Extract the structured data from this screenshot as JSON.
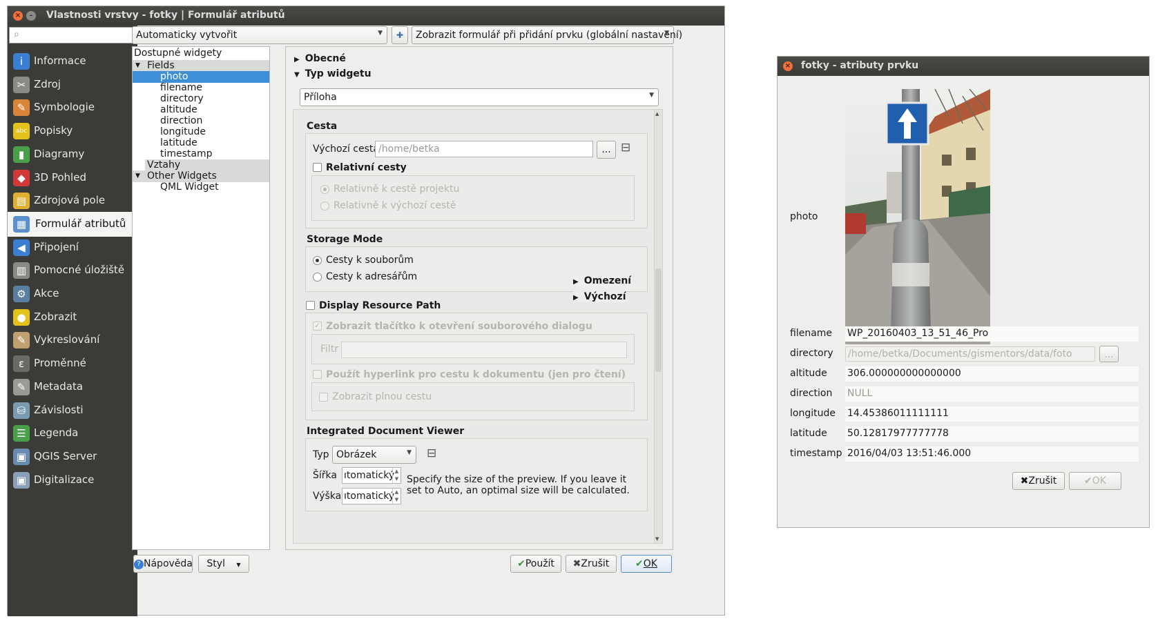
{
  "main_window": {
    "title": "Vlastnosti vrstvy - fotky | Formulář atributů",
    "close_glyph": "×",
    "minimize_glyph": "–",
    "sidebar": {
      "search_placeholder": "",
      "items": [
        {
          "label": "Informace",
          "icon": "info-icon",
          "color": "#3a7fd2",
          "glyph": "i"
        },
        {
          "label": "Zdroj",
          "icon": "wrench-icon",
          "color": "#8a8a86",
          "glyph": "✂"
        },
        {
          "label": "Symbologie",
          "icon": "brush-icon",
          "color": "#d9863a",
          "glyph": "✎"
        },
        {
          "label": "Popisky",
          "icon": "label-icon",
          "color": "#e3c21c",
          "glyph": "abc"
        },
        {
          "label": "Diagramy",
          "icon": "diagram-icon",
          "color": "#4aa04a",
          "glyph": "▮"
        },
        {
          "label": "3D Pohled",
          "icon": "cube-icon",
          "color": "#d23a3a",
          "glyph": "◆"
        },
        {
          "label": "Zdrojová pole",
          "icon": "fields-icon",
          "color": "#e0b030",
          "glyph": "▤"
        },
        {
          "label": "Formulář atributů",
          "icon": "form-icon",
          "color": "#5a8fd0",
          "glyph": "▦"
        },
        {
          "label": "Připojení",
          "icon": "join-icon",
          "color": "#3a7fd2",
          "glyph": "◀"
        },
        {
          "label": "Pomocné úložiště",
          "icon": "storage-icon",
          "color": "#8a8a86",
          "glyph": "▥"
        },
        {
          "label": "Akce",
          "icon": "gear-icon",
          "color": "#5a7fa0",
          "glyph": "⚙"
        },
        {
          "label": "Zobrazit",
          "icon": "speech-bubble-icon",
          "color": "#e3c21c",
          "glyph": "●"
        },
        {
          "label": "Vykreslování",
          "icon": "paintbrush-icon",
          "color": "#c0a070",
          "glyph": "✎"
        },
        {
          "label": "Proměnné",
          "icon": "epsilon-icon",
          "color": "#6a6a66",
          "glyph": "ε"
        },
        {
          "label": "Metadata",
          "icon": "metadata-icon",
          "color": "#9a9a96",
          "glyph": "✎"
        },
        {
          "label": "Závislosti",
          "icon": "dependencies-icon",
          "color": "#7a9ab0",
          "glyph": "⛁"
        },
        {
          "label": "Legenda",
          "icon": "legend-icon",
          "color": "#4aa04a",
          "glyph": "☰"
        },
        {
          "label": "QGIS Server",
          "icon": "server-icon",
          "color": "#6a8ab0",
          "glyph": "▣"
        },
        {
          "label": "Digitalizace",
          "icon": "digitize-icon",
          "color": "#8aa0b8",
          "glyph": "▣"
        }
      ],
      "active_index": 7
    },
    "toolbar": {
      "layout_combo": "Automaticky vytvořit",
      "python_icon": "python-icon",
      "python_glyph": "✚",
      "form_mode_combo": "Zobrazit formulář při přidání prvku (globální nastavení)"
    },
    "tree": {
      "header": "Dostupné widgety",
      "fields_group": "Fields",
      "fields": [
        "photo",
        "filename",
        "directory",
        "altitude",
        "direction",
        "longitude",
        "latitude",
        "timestamp"
      ],
      "selected_field": "photo",
      "relations_group": "Vztahy",
      "other_group": "Other Widgets",
      "other_items": [
        "QML Widget"
      ],
      "expand_glyph": "▼"
    },
    "panel": {
      "general_section": "Obecné",
      "widget_type_section": "Typ widgetu",
      "collapsed_glyph": "▶",
      "expanded_glyph": "▼",
      "widget_type": "Příloha",
      "path_group": "Cesta",
      "default_path_label": "Výchozí cesta",
      "default_path_placeholder": "/home/betka",
      "browse_button": "...",
      "expression_icon": "expression-icon",
      "expression_glyph": "⊟",
      "relative_paths_label": "Relativní cesty",
      "relative_project": "Relativně k cestě projektu",
      "relative_default": "Relativně k výchozí cestě",
      "storage_mode_group": "Storage Mode",
      "storage_files": "Cesty k souborům",
      "storage_dirs": "Cesty k adresářům",
      "constraints_section": "Omezení",
      "defaults_section": "Výchozí",
      "display_resource_path": "Display Resource Path",
      "show_file_dialog": "Zobrazit tlačítko k otevření souborového dialogu",
      "filter_label": "Filtr",
      "use_hyperlink": "Použít hyperlink pro cestu k dokumentu (jen pro čtení)",
      "show_full_path": "Zobrazit plnou cestu",
      "viewer_group": "Integrated Document Viewer",
      "type_label": "Typ",
      "type_value": "Obrázek",
      "width_label": "Šířka",
      "height_label": "Výška",
      "width_value": "ıtomatický",
      "height_value": "ıtomatický",
      "size_hint": "Specify the size of the preview. If you leave it set to Auto, an optimal size will be calculated.",
      "check_glyph": "✓",
      "spin_up": "▲",
      "spin_down": "▼"
    },
    "buttons": {
      "help": "Nápověda",
      "help_glyph": "?",
      "style": "Styl",
      "apply": "Použít",
      "cancel": "Zrušit",
      "ok": "OK",
      "apply_glyph": "✔",
      "cancel_glyph": "✖",
      "ok_glyph": "✔"
    }
  },
  "feature_window": {
    "title": "fotky - atributy prvku",
    "close_glyph": "×",
    "photo_label": "photo",
    "fields": [
      {
        "name": "filename",
        "value": "WP_20160403_13_51_46_Pro",
        "disabled": false
      },
      {
        "name": "directory",
        "value": "/home/betka/Documents/gismentors/data/foto",
        "disabled": true
      },
      {
        "name": "altitude",
        "value": "306.000000000000000",
        "disabled": false
      },
      {
        "name": "direction",
        "value": "NULL",
        "disabled": false
      },
      {
        "name": "longitude",
        "value": "14.45386011111111",
        "disabled": false
      },
      {
        "name": "latitude",
        "value": "50.12817977777778",
        "disabled": false
      },
      {
        "name": "timestamp",
        "value": "2016/04/03 13:51:46.000",
        "disabled": false
      }
    ],
    "browse_button": "...",
    "cancel": "Zrušit",
    "ok": "OK",
    "cancel_glyph": "✖",
    "ok_glyph": "✔"
  }
}
